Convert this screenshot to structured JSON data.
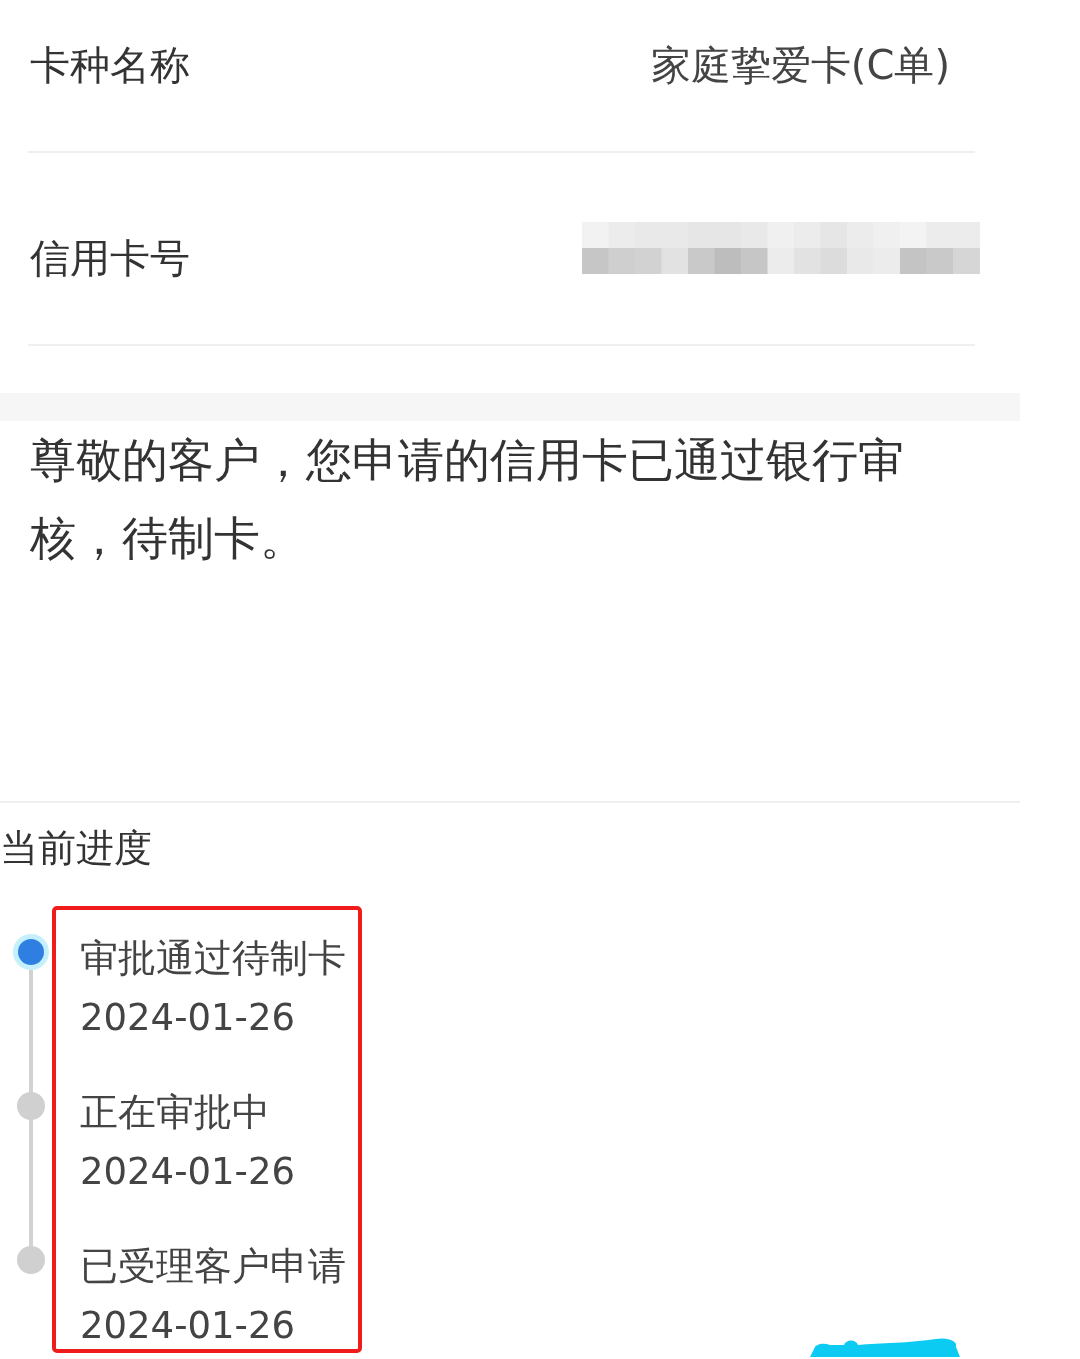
{
  "card_info": {
    "rows": [
      {
        "label": "卡种名称",
        "value": "家庭挚爱卡(C单)",
        "redacted": false
      },
      {
        "label": "信用卡号",
        "redacted": true
      }
    ]
  },
  "notice": {
    "text": "尊敬的客户，您申请的信用卡已通过银行审核，待制卡。"
  },
  "progress": {
    "title": "当前进度",
    "highlighted": true,
    "steps": [
      {
        "title": "审批通过待制卡",
        "date": "2024-01-26",
        "current": true
      },
      {
        "title": "正在审批中",
        "date": "2024-01-26",
        "current": false
      },
      {
        "title": "已受理客户申请",
        "date": "2024-01-26",
        "current": false
      }
    ]
  }
}
